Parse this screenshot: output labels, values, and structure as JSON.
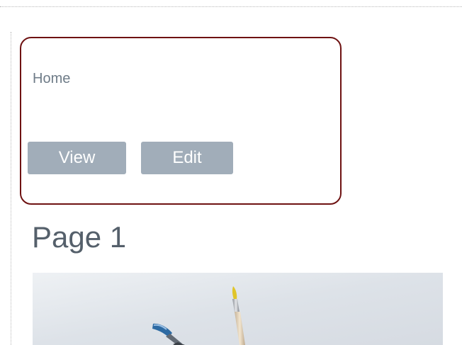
{
  "menu": {
    "title": "Home",
    "view_label": "View",
    "edit_label": "Edit"
  },
  "page": {
    "title": "Page 1"
  },
  "image": {
    "subject": "paintbrushes"
  },
  "colors": {
    "panel_border": "#6e1212",
    "button_bg": "#a1adb9",
    "title_text": "#55606b",
    "menu_text": "#6f7c88"
  }
}
